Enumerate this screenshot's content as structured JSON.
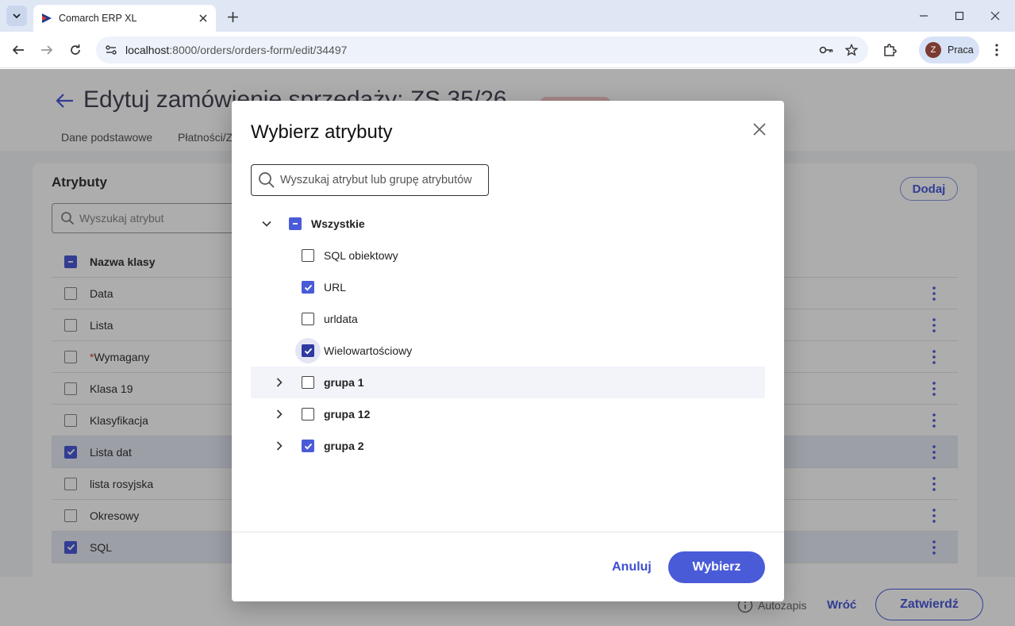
{
  "browser": {
    "tab_title": "Comarch ERP XL",
    "url_host": "localhost",
    "url_path": ":8000/orders/orders-form/edit/34497",
    "profile_initial": "Z",
    "profile_label": "Praca"
  },
  "app": {
    "page_title": "Edytuj zamówienie sprzedaży: ZS 35/26",
    "tabs": [
      "Dane podstawowe",
      "Płatności/Z"
    ],
    "panel": {
      "title": "Atrybuty",
      "add_label": "Dodaj",
      "search_placeholder": "Wyszukaj atrybut",
      "column_header": "Nazwa klasy",
      "rows": [
        {
          "name": "Data",
          "checked": false,
          "required": false
        },
        {
          "name": "Lista",
          "checked": false,
          "required": false
        },
        {
          "name": "Wymagany",
          "checked": false,
          "required": true
        },
        {
          "name": "Klasa 19",
          "checked": false,
          "required": false
        },
        {
          "name": "Klasyfikacja",
          "checked": false,
          "required": false
        },
        {
          "name": "Lista dat",
          "checked": true,
          "required": false
        },
        {
          "name": "lista rosyjska",
          "checked": false,
          "required": false
        },
        {
          "name": "Okresowy",
          "checked": false,
          "required": false
        },
        {
          "name": "SQL",
          "checked": true,
          "required": false
        }
      ],
      "required_marker": "*"
    },
    "footer": {
      "autosave_label": "Autozapis",
      "back_label": "Wróć",
      "confirm_label": "Zatwierdź"
    }
  },
  "modal": {
    "title": "Wybierz atrybuty",
    "search_placeholder": "Wyszukaj atrybut lub grupę atrybutów",
    "root": {
      "label": "Wszystkie",
      "state": "indeterminate",
      "expanded": true
    },
    "children": [
      {
        "label": "SQL obiektowy",
        "checked": false
      },
      {
        "label": "URL",
        "checked": true
      },
      {
        "label": "urldata",
        "checked": false
      },
      {
        "label": "Wielowartościowy",
        "checked": true,
        "focused": true
      }
    ],
    "groups": [
      {
        "label": "grupa 1",
        "checked": false,
        "expanded": false,
        "hovered": true
      },
      {
        "label": "grupa 12",
        "checked": false,
        "expanded": false
      },
      {
        "label": "grupa 2",
        "checked": true,
        "expanded": false
      }
    ],
    "cancel_label": "Anuluj",
    "submit_label": "Wybierz"
  },
  "colors": {
    "accent": "#4a5bd8",
    "accent_dark": "#2e3a9f",
    "overlay": "rgba(0,0,0,0.32)"
  }
}
